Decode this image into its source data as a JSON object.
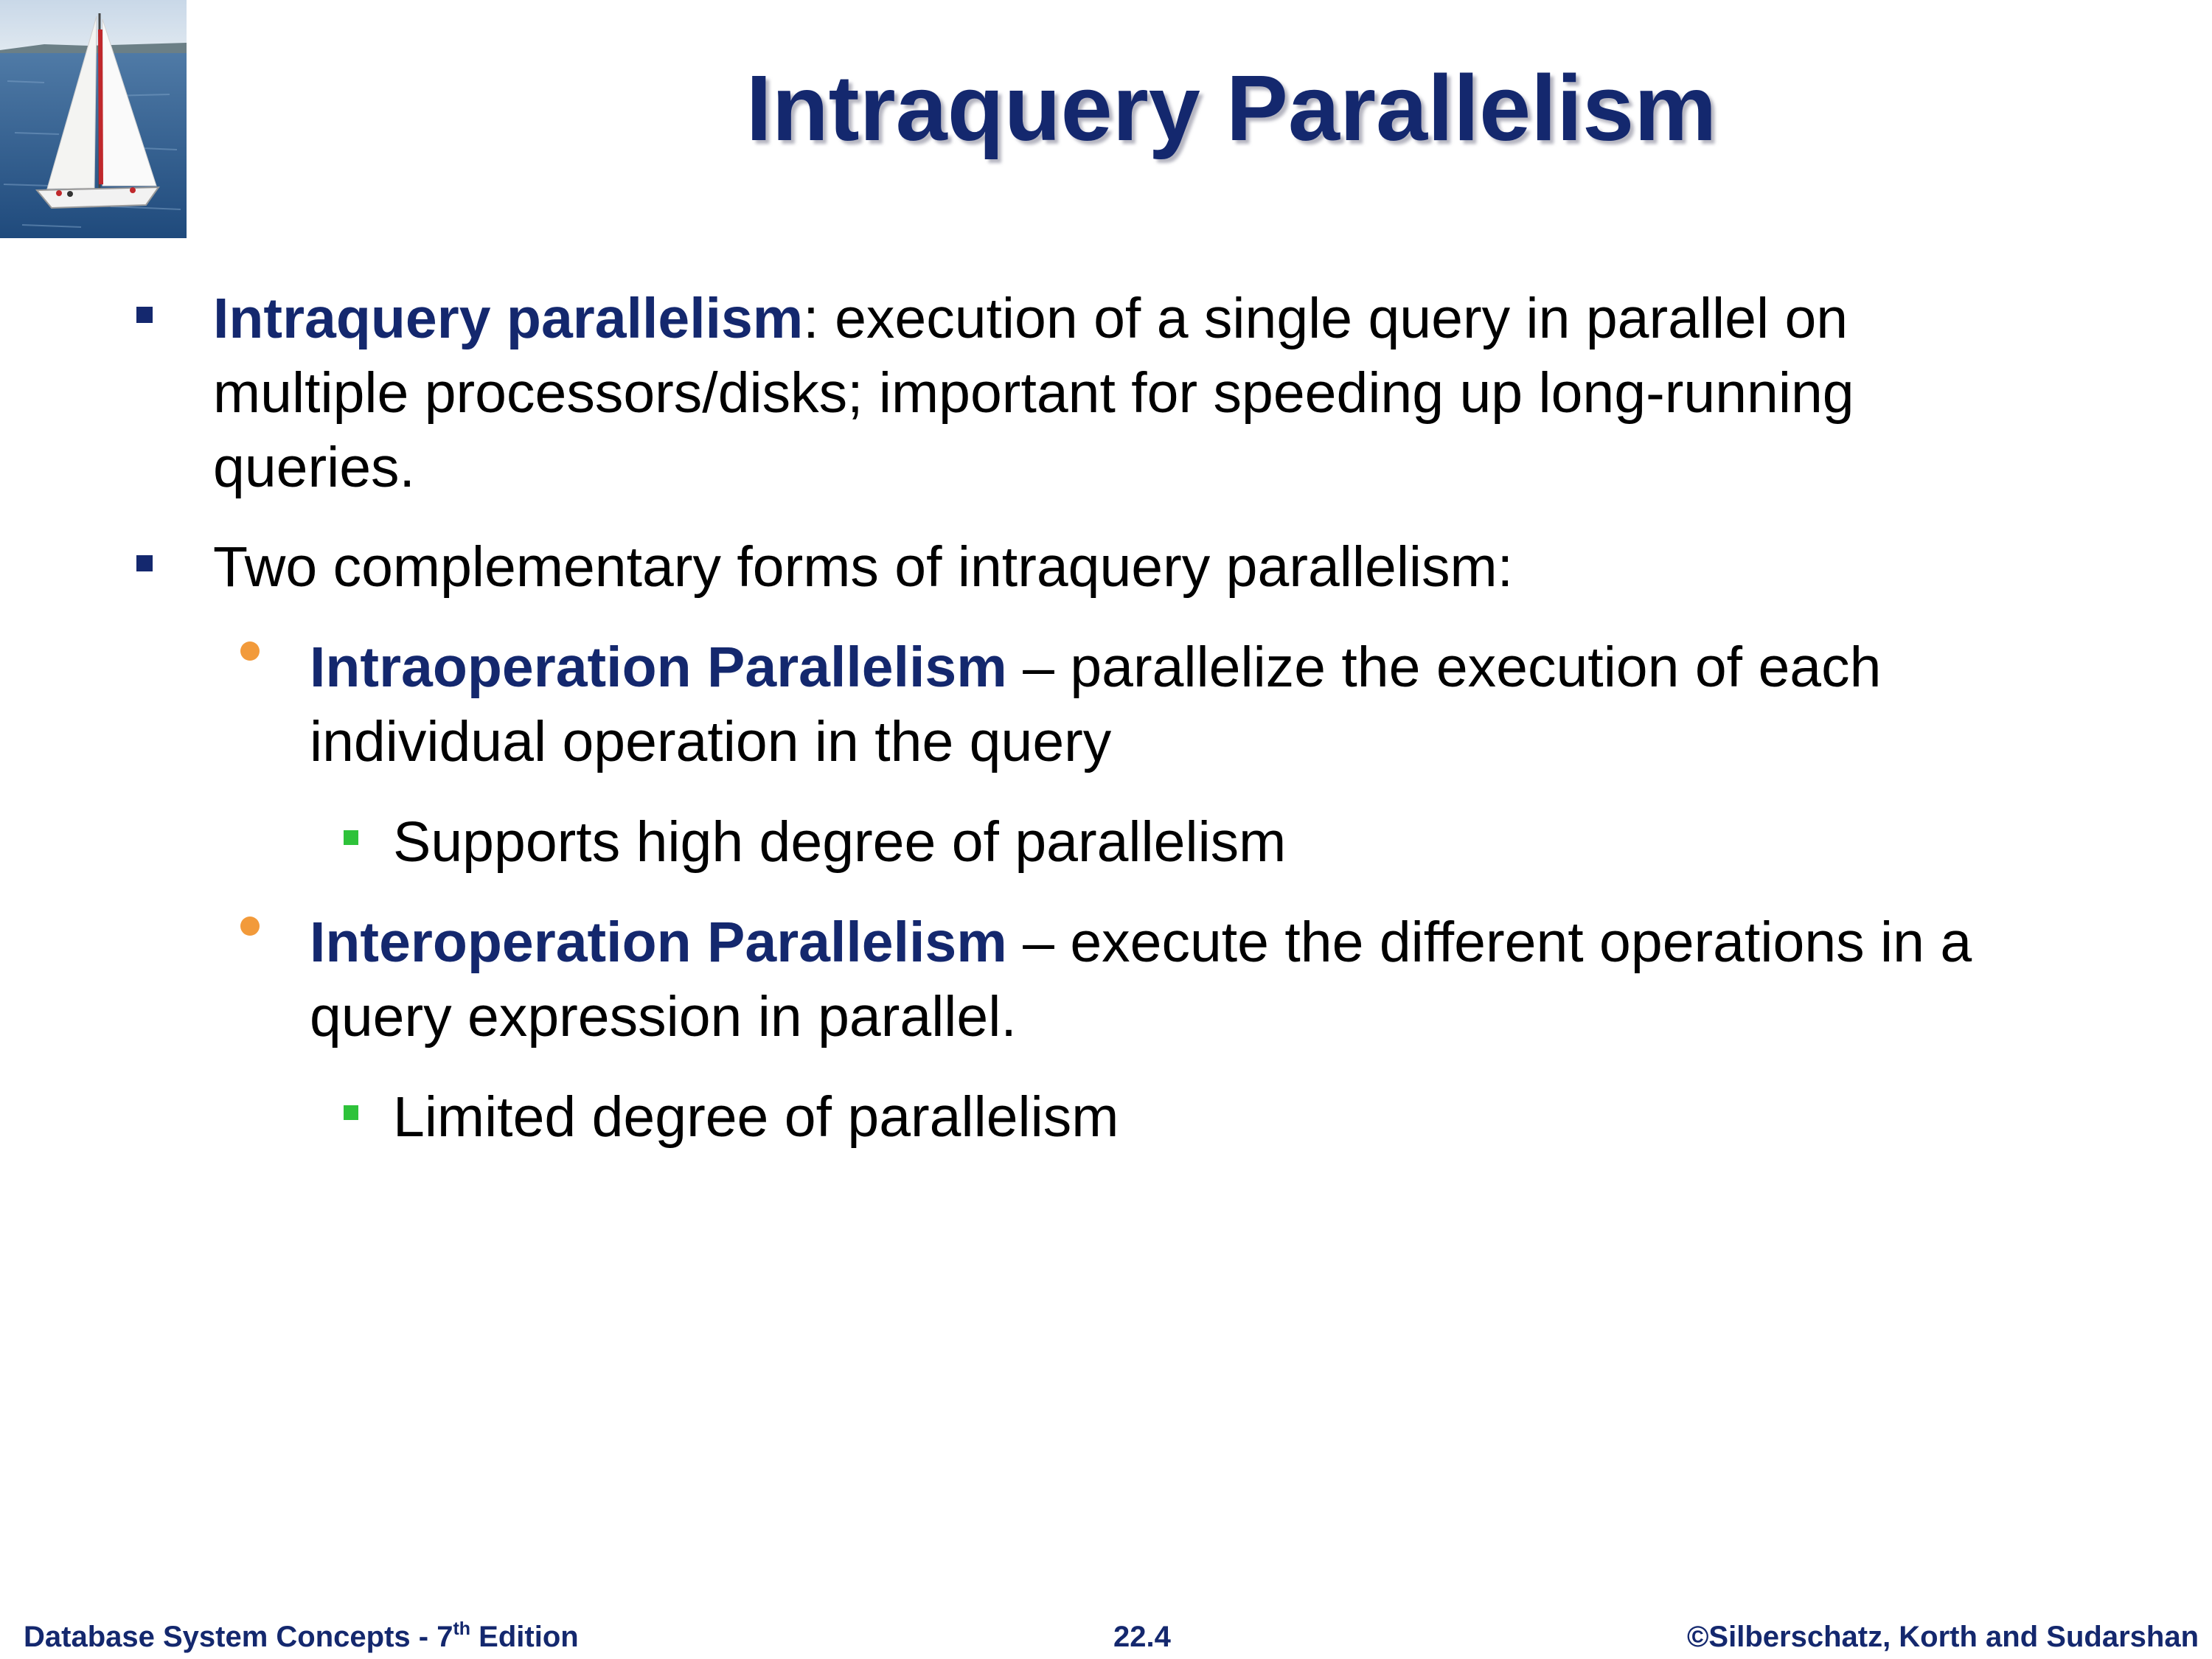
{
  "slide": {
    "title": "Intraquery Parallelism",
    "image_alt": "sailboat-image"
  },
  "bullets": [
    {
      "term": "Intraquery parallelism",
      "line1": ": execution of a single query in parallel on",
      "line2": "multiple processors/disks; important for speeding up long-running",
      "line3": "queries."
    },
    {
      "line1": "Two complementary forms of intraquery parallelism:"
    }
  ],
  "sub_bullets": [
    {
      "term": "Intraoperation Parallelism",
      "line1": " – parallelize the execution of each",
      "line2": "individual operation in the query",
      "detail": "Supports high degree of parallelism"
    },
    {
      "term": "Interoperation Parallelism",
      "line1": " – execute the different operations in a",
      "line2": "query expression in parallel.",
      "detail": "Limited degree of parallelism"
    }
  ],
  "footer": {
    "left_prefix": "Database System Concepts - 7",
    "left_sup": "th",
    "left_suffix": " Edition",
    "center": "22.4",
    "right": "©Silberschatz, Korth and Sudarshan"
  },
  "colors": {
    "title": "#14286e",
    "emphasis": "#14286e",
    "level1_marker": "#14286e",
    "level2_marker": "#f29a3a",
    "level3_marker": "#2ec23a"
  }
}
